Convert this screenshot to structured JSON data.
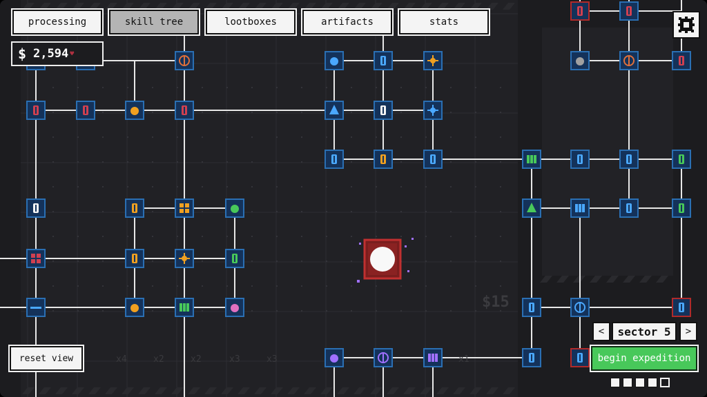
{
  "tabs": [
    {
      "label": "processing",
      "active": false
    },
    {
      "label": "skill tree",
      "active": true
    },
    {
      "label": "lootboxes",
      "active": false
    },
    {
      "label": "artifacts",
      "active": false
    },
    {
      "label": "stats",
      "active": false
    }
  ],
  "currency": {
    "symbol": "$",
    "amount": "2,594",
    "heart": "♥"
  },
  "reset_view_label": "reset view",
  "sector": {
    "label": "sector 5",
    "prev": "<",
    "next": ">"
  },
  "begin_label": "begin expedition",
  "progress": {
    "filled": 4,
    "total": 5
  },
  "settings_icon": "gear-icon",
  "background_labels": [
    "x4",
    "x2",
    "x2",
    "x3",
    "x3",
    "x1"
  ],
  "background_amount": "$15",
  "colors": {
    "background": "#1c1c1f",
    "node_blue_border": "#2a6fb3",
    "node_red_border": "#b02a2a",
    "connector": "#e8e8e8",
    "begin_button": "#48c85a",
    "core": "#b02a2a"
  },
  "nodes": [
    {
      "icon": "bolt-icon",
      "color": "#48c85a"
    },
    {
      "icon": "diamond-icon",
      "color": "#d04050"
    },
    {
      "icon": "swirl-icon",
      "color": "#e0703a"
    },
    {
      "icon": "orb-icon",
      "color": "#4aa8ff"
    },
    {
      "icon": "capsule-icon",
      "color": "#4aa8ff"
    },
    {
      "icon": "sun-icon",
      "color": "#f0a020"
    },
    {
      "icon": "arrows-up-icon",
      "color": "#4aa8ff"
    },
    {
      "icon": "flag-icon",
      "color": "#f4f4f4"
    },
    {
      "icon": "cog-icon",
      "color": "#4aa8ff"
    },
    {
      "icon": "bottle-icon",
      "color": "#4aa8ff"
    },
    {
      "icon": "bottle-icon",
      "color": "#f0a020"
    },
    {
      "icon": "link-icon",
      "color": "#4aa8ff"
    },
    {
      "icon": "dynamite-icon",
      "color": "#d04050"
    },
    {
      "icon": "flask-icon",
      "color": "#d04050"
    },
    {
      "icon": "rock-icon",
      "color": "#f0a020"
    },
    {
      "icon": "dynamite-icon",
      "color": "#d04050"
    },
    {
      "icon": "drill-icon",
      "color": "#f4f4f4"
    },
    {
      "icon": "pizza-icon",
      "color": "#f0a020"
    },
    {
      "icon": "crate-icon",
      "color": "#f0a020"
    },
    {
      "icon": "bomb-icon",
      "color": "#48c85a"
    },
    {
      "icon": "grid-icon",
      "color": "#d04050"
    },
    {
      "icon": "bell-icon",
      "color": "#f0a020"
    },
    {
      "icon": "radiation-icon",
      "color": "#f0a020"
    },
    {
      "icon": "drone-icon",
      "color": "#48c85a"
    },
    {
      "icon": "dash-icon",
      "color": "#4aa8ff"
    },
    {
      "icon": "rocket-icon",
      "color": "#f0a020"
    },
    {
      "icon": "triple-icon",
      "color": "#48c85a"
    },
    {
      "icon": "heart-rock-icon",
      "color": "#e070c0"
    },
    {
      "icon": "drill-red-icon",
      "color": "#d04050"
    },
    {
      "icon": "drill-red-icon",
      "color": "#d04050"
    },
    {
      "icon": "rock-grey-icon",
      "color": "#a0a0a0"
    },
    {
      "icon": "swirl-icon",
      "color": "#e0703a"
    },
    {
      "icon": "flask-icon",
      "color": "#d04050"
    },
    {
      "icon": "pair-icon",
      "color": "#48c85a"
    },
    {
      "icon": "loop-icon",
      "color": "#4aa8ff"
    },
    {
      "icon": "pin-icon",
      "color": "#4aa8ff"
    },
    {
      "icon": "cash-icon",
      "color": "#48c85a"
    },
    {
      "icon": "arrows-up-icon",
      "color": "#48c85a"
    },
    {
      "icon": "pair-icon",
      "color": "#4aa8ff"
    },
    {
      "icon": "exclaim-icon",
      "color": "#4aa8ff"
    },
    {
      "icon": "expand-icon",
      "color": "#48c85a"
    },
    {
      "icon": "beaker-icon",
      "color": "#4aa8ff"
    },
    {
      "icon": "target-icon",
      "color": "#4aa8ff"
    },
    {
      "icon": "lightning-icon",
      "color": "#4aa8ff"
    },
    {
      "icon": "bug-icon",
      "color": "#4aa8ff"
    },
    {
      "icon": "vial-icon",
      "color": "#4aa8ff"
    },
    {
      "icon": "rocket-purple-icon",
      "color": "#a070ff"
    },
    {
      "icon": "crosshair-icon",
      "color": "#a070ff"
    },
    {
      "icon": "triple-purple-icon",
      "color": "#a070ff"
    }
  ]
}
